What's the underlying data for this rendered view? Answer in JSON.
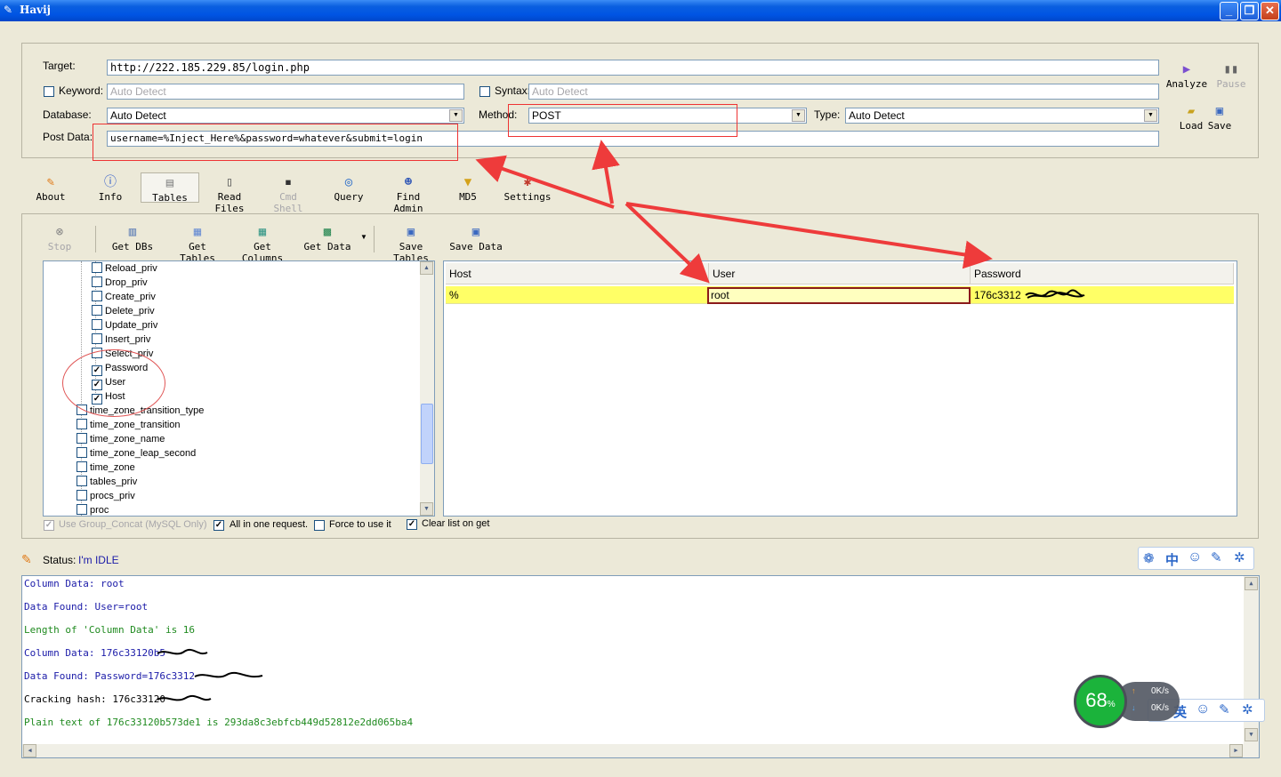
{
  "window": {
    "title": "Havij",
    "minimize": "_",
    "restore": "❐",
    "close": "✕"
  },
  "target": {
    "target_label": "Target:",
    "target_value": "http://222.185.229.85/login.php",
    "keyword_label": "Keyword:",
    "keyword_placeholder": "Auto Detect",
    "syntax_label": "Syntax:",
    "syntax_placeholder": "Auto Detect",
    "database_label": "Database:",
    "database_value": "Auto Detect",
    "method_label": "Method:",
    "method_value": "POST",
    "type_label": "Type:",
    "type_value": "Auto Detect",
    "post_label": "Post Data:",
    "post_value": "username=%Inject_Here%&password=whatever&submit=login"
  },
  "actions": {
    "analyze": "Analyze",
    "pause": "Pause",
    "load": "Load",
    "save": "Save"
  },
  "main_tabs": [
    {
      "label": "About",
      "icon": "carrot-icon"
    },
    {
      "label": "Info",
      "icon": "info-icon"
    },
    {
      "label": "Tables",
      "icon": "table-icon"
    },
    {
      "label": "Read Files",
      "icon": "file-icon"
    },
    {
      "label": "Cmd Shell",
      "icon": "terminal-icon"
    },
    {
      "label": "Query",
      "icon": "query-icon"
    },
    {
      "label": "Find Admin",
      "icon": "admin-icon"
    },
    {
      "label": "MD5",
      "icon": "funnel-icon"
    },
    {
      "label": "Settings",
      "icon": "tools-icon"
    }
  ],
  "tables_toolbar": {
    "stop": "Stop",
    "get_dbs": "Get DBs",
    "get_tables": "Get Tables",
    "get_columns": "Get Columns",
    "get_data": "Get Data",
    "save_tables": "Save Tables",
    "save_data": "Save Data"
  },
  "tree": {
    "columns": [
      {
        "label": "Reload_priv",
        "checked": false
      },
      {
        "label": "Drop_priv",
        "checked": false
      },
      {
        "label": "Create_priv",
        "checked": false
      },
      {
        "label": "Delete_priv",
        "checked": false
      },
      {
        "label": "Update_priv",
        "checked": false
      },
      {
        "label": "Insert_priv",
        "checked": false
      },
      {
        "label": "Select_priv",
        "checked": false
      },
      {
        "label": "Password",
        "checked": true
      },
      {
        "label": "User",
        "checked": true
      },
      {
        "label": "Host",
        "checked": true
      }
    ],
    "tables": [
      {
        "label": "time_zone_transition_type",
        "checked": false
      },
      {
        "label": "time_zone_transition",
        "checked": false
      },
      {
        "label": "time_zone_name",
        "checked": false
      },
      {
        "label": "time_zone_leap_second",
        "checked": false
      },
      {
        "label": "time_zone",
        "checked": false
      },
      {
        "label": "tables_priv",
        "checked": false
      },
      {
        "label": "procs_priv",
        "checked": false
      },
      {
        "label": "proc",
        "checked": false
      }
    ]
  },
  "options": {
    "group_concat": "Use Group_Concat (MySQL Only)",
    "all_in_one": "All in one request.",
    "force": "Force to use it",
    "clear_list": "Clear list on get"
  },
  "grid": {
    "headers": [
      "Host",
      "User",
      "Password"
    ],
    "row": {
      "host": "%",
      "user": "root",
      "password": "176c3312"
    }
  },
  "status": {
    "label": "Status:",
    "value": "I'm IDLE"
  },
  "log": [
    {
      "text": "Column Data: root",
      "color": "#1a1aa8"
    },
    {
      "text": "Data Found: User=root",
      "color": "#1a1aa8"
    },
    {
      "text": "Length of 'Column Data' is 16",
      "color": "#1f8a1f"
    },
    {
      "text": "Column Data: 176c33120b5",
      "color": "#1a1aa8"
    },
    {
      "text": "Data Found: Password=176c3312",
      "color": "#1a1aa8"
    },
    {
      "text": "Cracking hash: 176c33120",
      "color": "#000000"
    },
    {
      "text": "Plain text of 176c33120b573de1 is 293da8c3ebfcb449d52812e2dd065ba4",
      "color": "#1f8a1f"
    }
  ],
  "ime_bar": {
    "chinese": "中",
    "english": "英"
  },
  "speed_widget": {
    "percent": "68",
    "percent_sign": "%",
    "up": "0K/s",
    "down": "0K/s"
  }
}
